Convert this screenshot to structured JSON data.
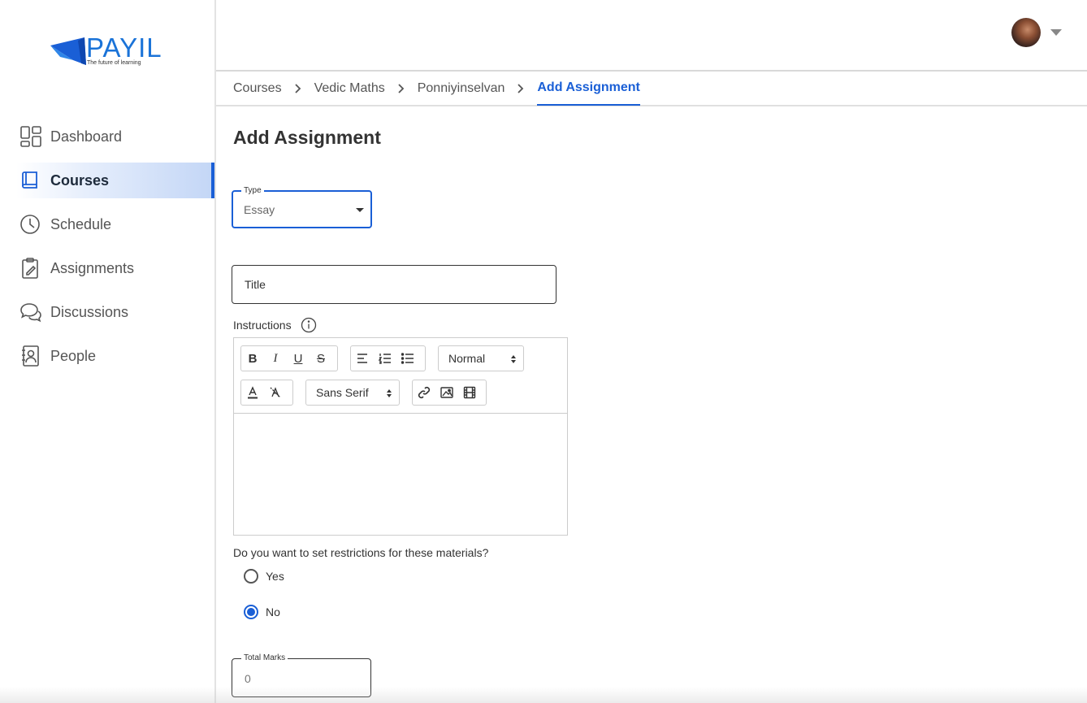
{
  "brand": {
    "name": "PAYIL",
    "tagline": "The future of learning",
    "accent": "#1a5fd6"
  },
  "sidebar": {
    "items": [
      {
        "label": "Dashboard",
        "icon": "dashboard-icon",
        "active": false
      },
      {
        "label": "Courses",
        "icon": "book-icon",
        "active": true
      },
      {
        "label": "Schedule",
        "icon": "clock-icon",
        "active": false
      },
      {
        "label": "Assignments",
        "icon": "clipboard-icon",
        "active": false
      },
      {
        "label": "Discussions",
        "icon": "chat-bubbles-icon",
        "active": false
      },
      {
        "label": "People",
        "icon": "person-card-icon",
        "active": false
      }
    ]
  },
  "header": {
    "avatar_icon": "user-avatar",
    "menu_icon": "caret-down-icon"
  },
  "breadcrumb": [
    "Courses",
    "Vedic Maths",
    "Ponniyinselvan",
    "Add Assignment"
  ],
  "page": {
    "title": "Add Assignment"
  },
  "form": {
    "type": {
      "label": "Type",
      "value": "Essay"
    },
    "title": {
      "placeholder": "Title",
      "value": ""
    },
    "instructions": {
      "label": "Instructions",
      "info_icon": "info-icon"
    },
    "editor": {
      "heading_select": "Normal",
      "font_select": "Sans Serif",
      "tools": [
        "bold",
        "italic",
        "underline",
        "strike",
        "align",
        "ordered-list",
        "bullet-list",
        "text-color",
        "clear-format",
        "link",
        "image",
        "video"
      ]
    },
    "restrictions": {
      "question": "Do you want to set restrictions for these materials?",
      "options": [
        {
          "label": "Yes",
          "checked": false
        },
        {
          "label": "No",
          "checked": true
        }
      ]
    },
    "total_marks": {
      "label": "Total Marks",
      "value": "0"
    }
  }
}
